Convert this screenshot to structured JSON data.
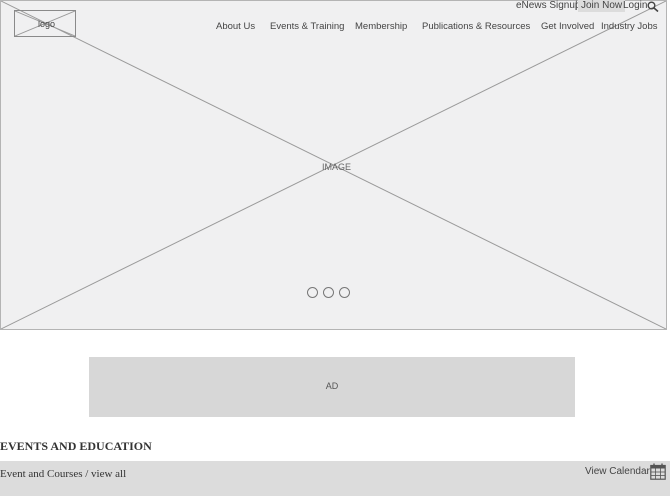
{
  "hero": {
    "image_label": "IMAGE",
    "slide_count": 3
  },
  "logo": {
    "label": "logo"
  },
  "utility_nav": {
    "enews": "eNews Signup",
    "separator": "|",
    "join": "Join Now",
    "login": "Login"
  },
  "main_nav": {
    "items": [
      "About Us",
      "Events & Training",
      "Membership",
      "Publications & Resources",
      "Get Involved",
      "Industry Jobs"
    ]
  },
  "ad": {
    "label": "AD"
  },
  "events": {
    "section_title": "EVENTS AND EDUCATION",
    "tab_label": "Event and Courses",
    "divider": " / ",
    "view_all": "view all",
    "view_calendar": "View Calendar"
  },
  "icons": {
    "search": "search-icon",
    "calendar": "calendar-icon"
  }
}
